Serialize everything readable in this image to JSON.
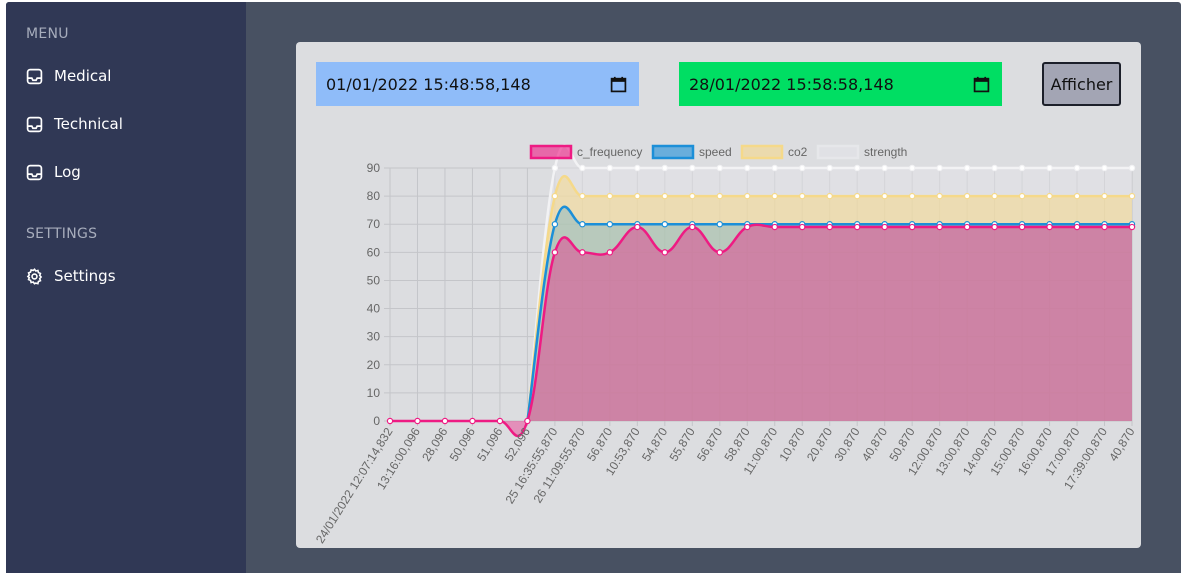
{
  "sidebar": {
    "menu_header": "MENU",
    "items": [
      {
        "label": "Medical",
        "icon": "inbox-icon"
      },
      {
        "label": "Technical",
        "icon": "inbox-icon"
      },
      {
        "label": "Log",
        "icon": "inbox-icon"
      }
    ],
    "settings_header": "SETTINGS",
    "settings_item": {
      "label": "Settings",
      "icon": "gear-icon"
    }
  },
  "filters": {
    "start_value": "01/01/2022 15:48:58,148",
    "end_value": "28/01/2022 15:58:58,148",
    "submit_label": "Afficher"
  },
  "colors": {
    "c_frequency": "#ee1b83",
    "speed": "#1c8fd8",
    "co2": "#f5d98a",
    "strength": "#e3e4e7",
    "start_input_bg": "#8fbcf9",
    "end_input_bg": "#00de63"
  },
  "chart_data": {
    "type": "area",
    "legend_position": "top",
    "grid": true,
    "ylim": [
      0,
      90
    ],
    "yticks": [
      0,
      10,
      20,
      30,
      40,
      50,
      60,
      70,
      80,
      90
    ],
    "categories": [
      "24/01/2022 12:07:14,832",
      "13:16:00,096",
      "28,096",
      "50,096",
      "51,096",
      "52,096",
      "25 16:35:55,870",
      "26 11:09:55,870",
      "56,870",
      "10:53,870",
      "54,870",
      "55,870",
      "56,870",
      "58,870",
      "11:00,870",
      "10,870",
      "20,870",
      "30,870",
      "40,870",
      "50,870",
      "12:00,870",
      "13:00,870",
      "14:00,870",
      "15:00,870",
      "16:00,870",
      "17:00,870",
      "17:39:00,870",
      "40,870"
    ],
    "series": [
      {
        "name": "c_frequency",
        "values": [
          0,
          0,
          0,
          0,
          0,
          0,
          60,
          60,
          60,
          69,
          60,
          69,
          60,
          69,
          69,
          69,
          69,
          69,
          69,
          69,
          69,
          69,
          69,
          69,
          69,
          69,
          69,
          69
        ]
      },
      {
        "name": "speed",
        "values": [
          null,
          null,
          null,
          null,
          null,
          null,
          70,
          70,
          70,
          70,
          70,
          70,
          70,
          70,
          70,
          70,
          70,
          70,
          70,
          70,
          70,
          70,
          70,
          70,
          70,
          70,
          70,
          70
        ]
      },
      {
        "name": "co2",
        "values": [
          null,
          null,
          null,
          null,
          null,
          null,
          80,
          80,
          80,
          80,
          80,
          80,
          80,
          80,
          80,
          80,
          80,
          80,
          80,
          80,
          80,
          80,
          80,
          80,
          80,
          80,
          80,
          80
        ]
      },
      {
        "name": "strength",
        "values": [
          null,
          null,
          null,
          null,
          null,
          null,
          90,
          90,
          90,
          90,
          90,
          90,
          90,
          90,
          90,
          90,
          90,
          90,
          90,
          90,
          90,
          90,
          90,
          90,
          90,
          90,
          90,
          90
        ]
      }
    ]
  }
}
